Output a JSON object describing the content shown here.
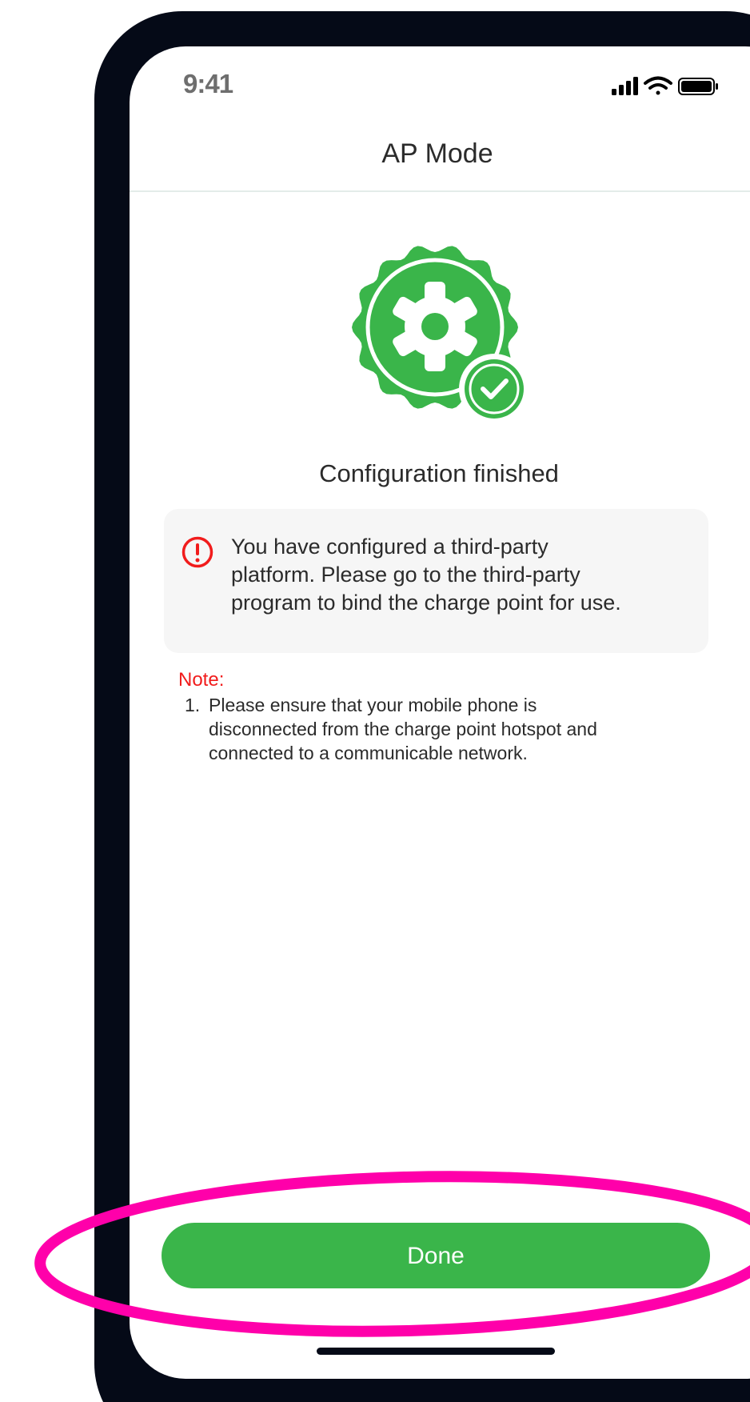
{
  "status_bar": {
    "time": "9:41",
    "icons": [
      "signal-icon",
      "wifi-icon",
      "battery-icon"
    ]
  },
  "header": {
    "title": "AP Mode"
  },
  "hero": {
    "icon": "gear-check-badge-icon",
    "color": "#3ab54a"
  },
  "result": {
    "title": "Configuration finished"
  },
  "info_card": {
    "icon": "alert-circle-icon",
    "icon_color": "#f11c1c",
    "lines": [
      "You have configured a third-party",
      "platform. Please go to the third-party",
      "program to bind the charge point for use."
    ]
  },
  "note": {
    "label": "Note:",
    "label_color": "#f11c1c",
    "items": [
      {
        "number": "1.",
        "lines": [
          "Please ensure that your mobile phone is",
          "disconnected from the charge point hotspot and",
          "connected to a communicable network."
        ]
      }
    ]
  },
  "actions": {
    "done_label": "Done",
    "done_color": "#3ab54a"
  },
  "annotation": {
    "highlight_color": "#ff00aa"
  }
}
